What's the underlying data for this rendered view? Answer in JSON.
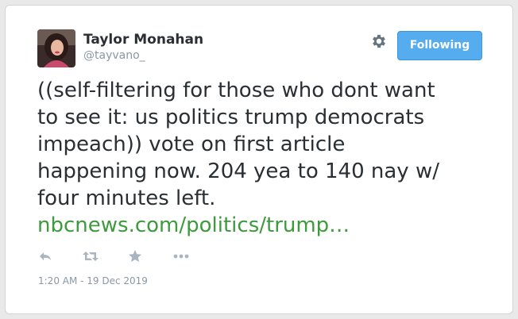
{
  "author": {
    "name": "Taylor Monahan",
    "handle": "@tayvano_"
  },
  "follow_button": {
    "label": "Following"
  },
  "tweet": {
    "lines": [
      "((self-filtering for those who dont want",
      "to see it: us politics trump democrats",
      "impeach)) vote on first article",
      "happening now. 204 yea to 140 nay w/",
      "four minutes left."
    ],
    "link_text": "nbcnews.com/politics/trump…"
  },
  "actions": {
    "icons": [
      "reply-icon",
      "retweet-icon",
      "like-icon",
      "more-icon"
    ]
  },
  "timestamp": "1:20 AM - 19 Dec 2019",
  "colors": {
    "button_bg": "#55acee",
    "link": "#3d9a3d",
    "text": "#292f33",
    "muted": "#8899a6",
    "icon": "#a9b6c2"
  }
}
